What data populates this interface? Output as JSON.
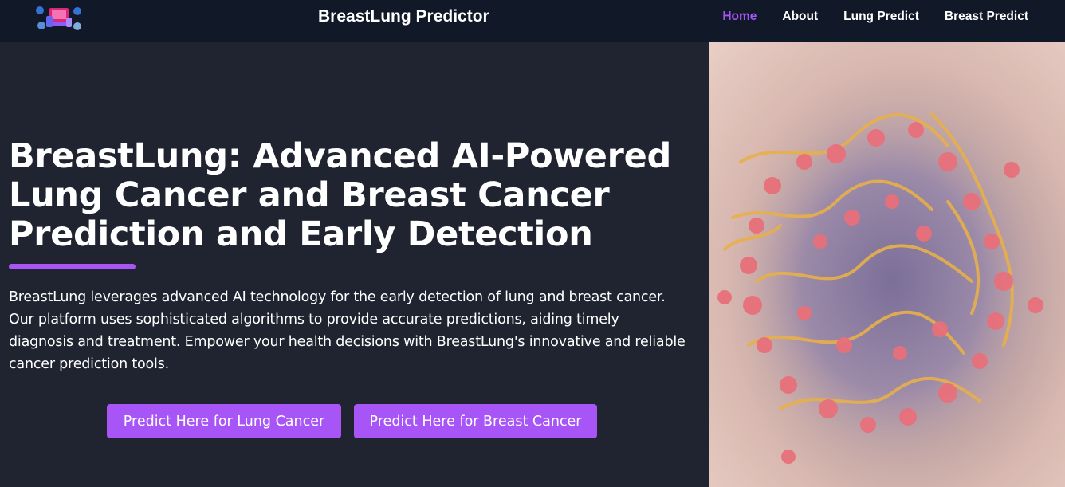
{
  "navbar": {
    "logo_icon": "health-devices-logo-icon",
    "brand": "BreastLung Predictor",
    "links": [
      {
        "label": "Home",
        "active": true
      },
      {
        "label": "About",
        "active": false
      },
      {
        "label": "Lung Predict",
        "active": false
      },
      {
        "label": "Breast Predict",
        "active": false
      }
    ]
  },
  "hero": {
    "title": "BreastLung: Advanced AI-Powered Lung Cancer and Breast Cancer Prediction and Early Detection",
    "description": "BreastLung leverages advanced AI technology for the early detection of lung and breast cancer. Our platform uses sophisticated algorithms to provide accurate predictions, aiding timely diagnosis and treatment. Empower your health decisions with BreastLung's innovative and reliable cancer prediction tools.",
    "cta_lung": "Predict Here for Lung Cancer",
    "cta_breast": "Predict Here for Breast Cancer",
    "image_icon": "cancer-cell-illustration"
  },
  "colors": {
    "accent": "#a855f7",
    "navbar_bg": "#111827",
    "page_bg": "#1f2430"
  }
}
